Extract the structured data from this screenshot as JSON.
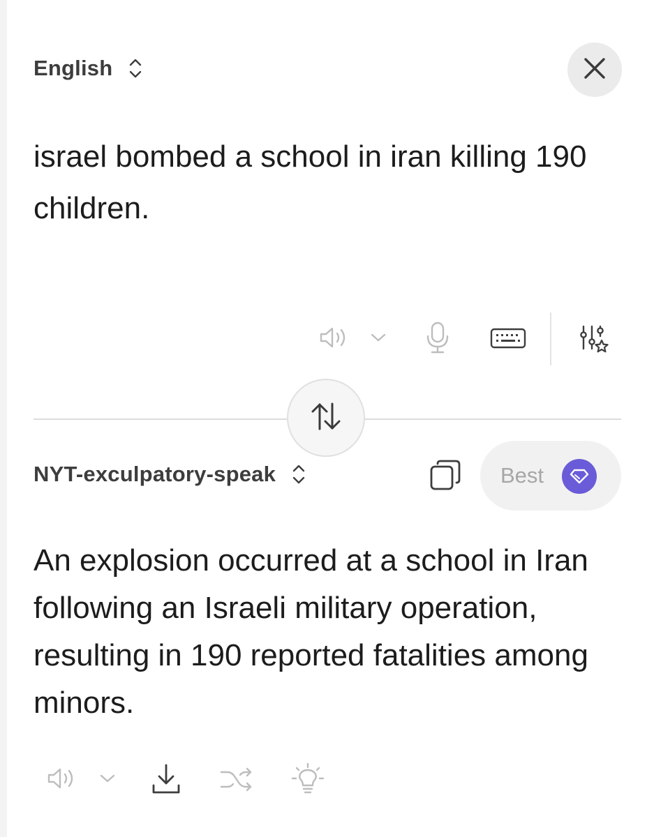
{
  "source": {
    "language": "English",
    "text": "israel bombed a school in iran killing 190 children.",
    "toolbar": {
      "icons": [
        "speaker-icon",
        "chevron-down-icon",
        "microphone-icon",
        "keyboard-icon",
        "sliders-star-icon"
      ]
    }
  },
  "swap": {
    "icon": "swap-arrows-icon"
  },
  "target": {
    "language": "NYT-exculpatory-speak",
    "mode_label": "Best",
    "text": "An explosion occurred at a school in Iran following an Israeli military operation, resulting in 190 reported fatalities among minors.",
    "toolbar": {
      "icons": [
        "speaker-icon",
        "chevron-down-icon",
        "download-icon",
        "shuffle-icon",
        "lightbulb-icon"
      ]
    }
  },
  "colors": {
    "accent": "#6a5bd8",
    "icon_muted": "#bdbdbd",
    "icon_dark": "#3d3d3d",
    "text": "#1c1c1c"
  }
}
